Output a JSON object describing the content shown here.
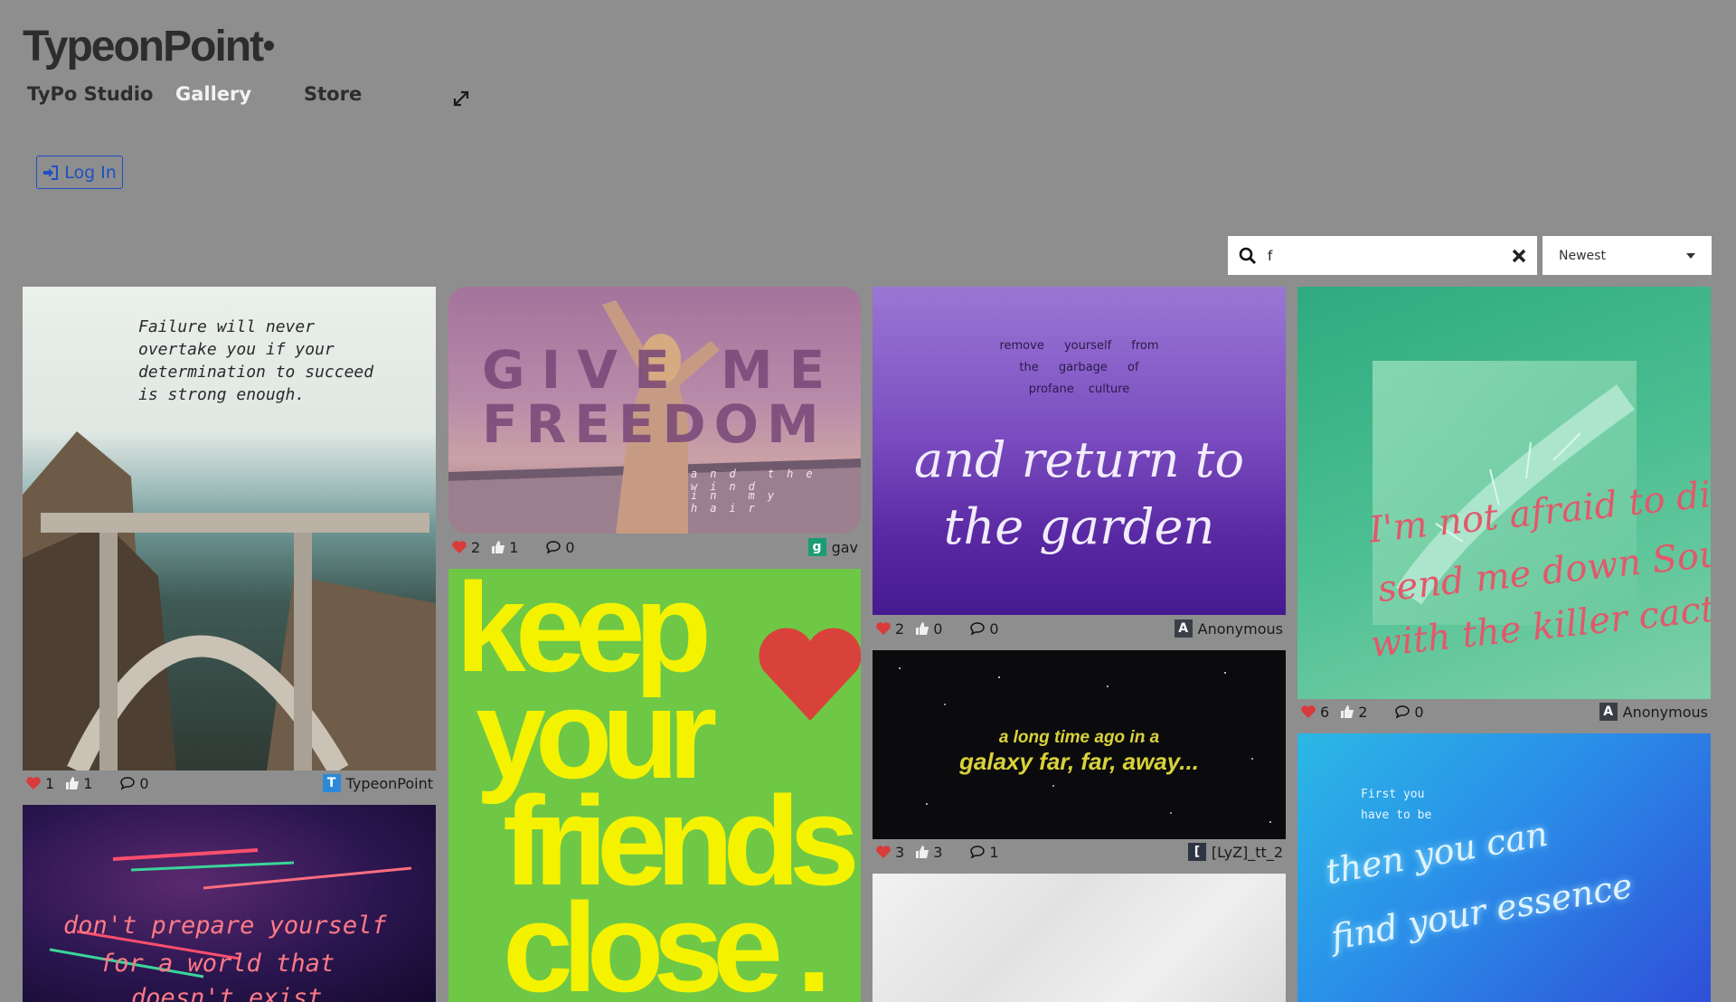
{
  "app": {
    "logo": "TypeonPoint"
  },
  "nav": {
    "studio": "TyPo Studio",
    "gallery": "Gallery",
    "store": "Store"
  },
  "auth": {
    "login": "Log In"
  },
  "search": {
    "value": "f"
  },
  "sort": {
    "selected": "Newest"
  },
  "colors": {
    "accent": "#1f4fc2",
    "heart": "#d93a3a",
    "background": "#8e8e8e"
  },
  "icons": [
    "expand-icon",
    "login-icon",
    "search-icon",
    "clear-icon",
    "heart-icon",
    "thumbs-up-icon",
    "comment-icon"
  ],
  "cards": [
    {
      "quote": "Failure will never overtake you if your determination to succeed is strong enough.",
      "likes": "1",
      "thumbs": "1",
      "comments": "0",
      "author": "TypeonPoint",
      "badge": "T",
      "badge_color": "#2b89d8"
    },
    {
      "quote1": "don't prepare yourself",
      "quote2": "for a world that",
      "quote3": "doesn't exist"
    },
    {
      "title1": "GIVE ME",
      "title2": "FREEDOM",
      "sub1": "and the wind",
      "sub2": "in my hair",
      "likes": "2",
      "thumbs": "1",
      "comments": "0",
      "author": "gav",
      "badge": "g",
      "badge_color": "#1a9c74"
    },
    {
      "line1": "keep",
      "line2": "your",
      "line3": "friends",
      "line4": "close ."
    },
    {
      "small1": "remove yourself from",
      "small2": "the garbage of",
      "small3": "profane culture",
      "script1": "and return to",
      "script2": "the garden",
      "likes": "2",
      "thumbs": "0",
      "comments": "0",
      "author": "Anonymous",
      "badge": "A",
      "badge_color": "#3a3f47"
    },
    {
      "line1": "a long time ago in a",
      "line2": "galaxy far, far, away...",
      "likes": "3",
      "thumbs": "3",
      "comments": "1",
      "author": "[LyZ]_tt_2",
      "badge": "[",
      "badge_color": "#2e3542"
    },
    {
      "line1": "I'm not afraid to die,",
      "line2": "send me down South",
      "line3": "with the killer cacti.",
      "likes": "6",
      "thumbs": "2",
      "comments": "0",
      "author": "Anonymous",
      "badge": "A",
      "badge_color": "#3a3f47"
    },
    {
      "small1": "First you",
      "small2": "have to be",
      "script1": "then you can",
      "script2": "find your essence"
    }
  ]
}
